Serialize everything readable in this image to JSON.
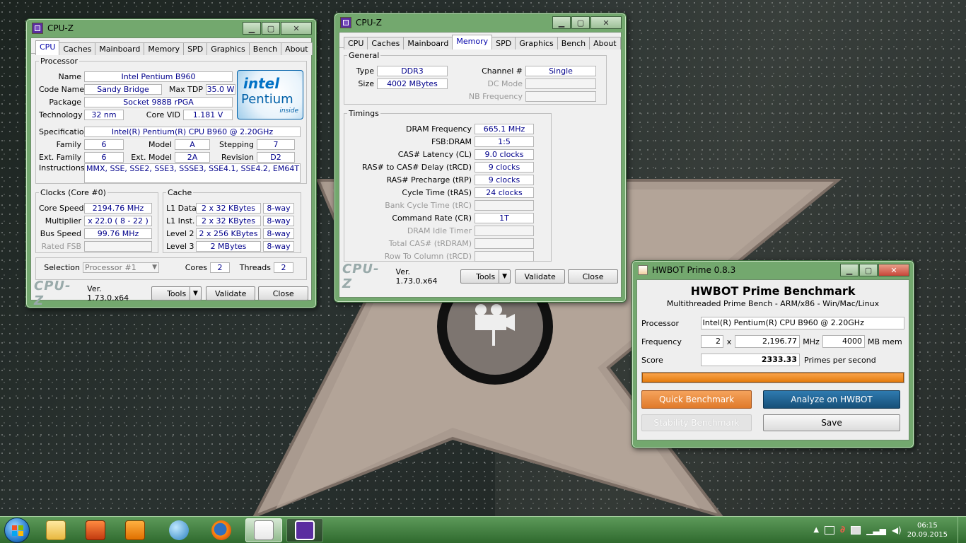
{
  "cpuz_cpu": {
    "title": "CPU-Z",
    "tabs": [
      "CPU",
      "Caches",
      "Mainboard",
      "Memory",
      "SPD",
      "Graphics",
      "Bench",
      "About"
    ],
    "processor_legend": "Processor",
    "name_label": "Name",
    "name": "Intel Pentium B960",
    "codename_label": "Code Name",
    "codename": "Sandy Bridge",
    "maxtdp_label": "Max TDP",
    "maxtdp": "35.0 W",
    "package_label": "Package",
    "package": "Socket 988B rPGA",
    "tech_label": "Technology",
    "tech": "32 nm",
    "corevid_label": "Core VID",
    "corevid": "1.181 V",
    "spec_label": "Specification",
    "spec": "Intel(R) Pentium(R) CPU B960 @ 2.20GHz",
    "family_label": "Family",
    "family": "6",
    "model_label": "Model",
    "model": "A",
    "stepping_label": "Stepping",
    "stepping": "7",
    "extfamily_label": "Ext. Family",
    "extfamily": "6",
    "extmodel_label": "Ext. Model",
    "extmodel": "2A",
    "revision_label": "Revision",
    "revision": "D2",
    "instr_label": "Instructions",
    "instr": "MMX, SSE, SSE2, SSE3, SSSE3, SSE4.1, SSE4.2, EM64T",
    "logo_brand": "intel",
    "logo_product": "Pentium",
    "logo_inside": "inside",
    "clocks_legend": "Clocks (Core #0)",
    "corespeed_label": "Core Speed",
    "corespeed": "2194.76 MHz",
    "multiplier_label": "Multiplier",
    "multiplier": "x 22.0 ( 8 - 22 )",
    "busspeed_label": "Bus Speed",
    "busspeed": "99.76 MHz",
    "ratedfsb_label": "Rated FSB",
    "ratedfsb": "",
    "cache_legend": "Cache",
    "l1d_label": "L1 Data",
    "l1d": "2 x 32 KBytes",
    "l1d_way": "8-way",
    "l1i_label": "L1 Inst.",
    "l1i": "2 x 32 KBytes",
    "l1i_way": "8-way",
    "l2_label": "Level 2",
    "l2": "2 x 256 KBytes",
    "l2_way": "8-way",
    "l3_label": "Level 3",
    "l3": "2 MBytes",
    "l3_way": "8-way",
    "selection_label": "Selection",
    "selection": "Processor #1",
    "cores_label": "Cores",
    "cores": "2",
    "threads_label": "Threads",
    "threads": "2",
    "brand": "CPU-Z",
    "version": "Ver. 1.73.0.x64",
    "tools": "Tools",
    "validate": "Validate",
    "close": "Close"
  },
  "cpuz_mem": {
    "title": "CPU-Z",
    "tabs": [
      "CPU",
      "Caches",
      "Mainboard",
      "Memory",
      "SPD",
      "Graphics",
      "Bench",
      "About"
    ],
    "general_legend": "General",
    "type_label": "Type",
    "type": "DDR3",
    "size_label": "Size",
    "size": "4002 MBytes",
    "channel_label": "Channel #",
    "channel": "Single",
    "dcmode_label": "DC Mode",
    "dcmode": "",
    "nbfreq_label": "NB Frequency",
    "nbfreq": "",
    "timings_legend": "Timings",
    "dramfreq_label": "DRAM Frequency",
    "dramfreq": "665.1 MHz",
    "fsbdram_label": "FSB:DRAM",
    "fsbdram": "1:5",
    "cl_label": "CAS# Latency (CL)",
    "cl": "9.0 clocks",
    "trcd_label": "RAS# to CAS# Delay (tRCD)",
    "trcd": "9 clocks",
    "trp_label": "RAS# Precharge (tRP)",
    "trp": "9 clocks",
    "tras_label": "Cycle Time (tRAS)",
    "tras": "24 clocks",
    "trc_label": "Bank Cycle Time (tRC)",
    "trc": "",
    "cr_label": "Command Rate (CR)",
    "cr": "1T",
    "idle_label": "DRAM Idle Timer",
    "idle": "",
    "trdram_label": "Total CAS# (tRDRAM)",
    "trdram": "",
    "rtc_label": "Row To Column (tRCD)",
    "rtc": "",
    "brand": "CPU-Z",
    "version": "Ver. 1.73.0.x64",
    "tools": "Tools",
    "validate": "Validate",
    "close": "Close"
  },
  "hwbot": {
    "title": "HWBOT Prime 0.8.3",
    "heading": "HWBOT Prime Benchmark",
    "subheading": "Multithreaded Prime Bench - ARM/x86 - Win/Mac/Linux",
    "processor_label": "Processor",
    "processor": "Intel(R) Pentium(R) CPU B960 @ 2.20GHz",
    "frequency_label": "Frequency",
    "threads": "2",
    "x": "x",
    "mhz_value": "2,196.77",
    "mhz": "MHz",
    "mem_value": "4000",
    "mem_unit": "MB mem",
    "score_label": "Score",
    "score": "2333.33",
    "score_unit": "Primes per second",
    "progress": 1.0,
    "quick": "Quick Benchmark",
    "analyze": "Analyze on HWBOT",
    "stability": "Stability Benchmark",
    "save": "Save"
  },
  "taskbar": {
    "time": "06:15",
    "date": "20.09.2015",
    "apps": [
      "explorer-icon",
      "security-icon",
      "media-player-icon",
      "network-icon",
      "firefox-icon",
      "java-icon",
      "cpuz-icon"
    ]
  },
  "colors": {
    "accent": "#73a86e",
    "hwbot_orange": "#e57d10",
    "hwbot_blue": "#1d5f8a",
    "value_text": "#00008b"
  }
}
